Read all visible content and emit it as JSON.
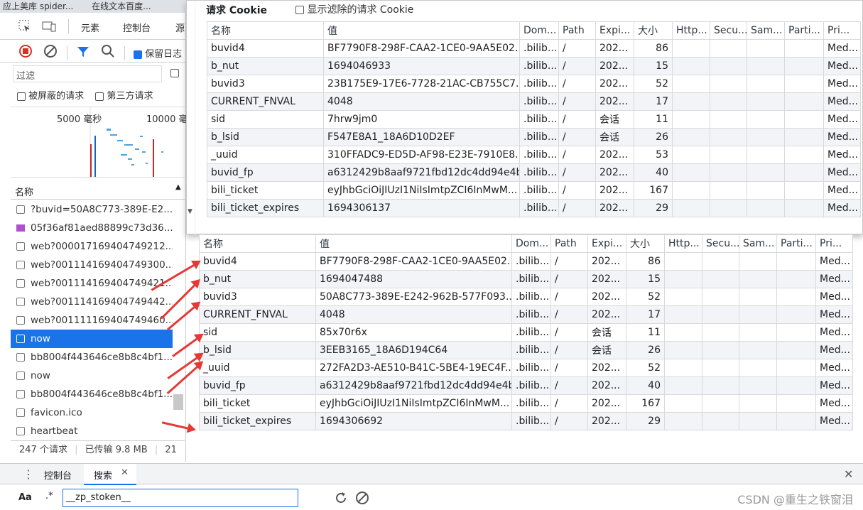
{
  "browser_tabs": [
    "应上美库 spider...",
    "在线文本百度..."
  ],
  "devtools": {
    "panels": [
      "元素",
      "控制台",
      "源"
    ],
    "preserve_log": "保留日志",
    "filter_placeholder": "过滤",
    "blocked_requests": "被屏蔽的请求",
    "third_party": "第三方请求",
    "overview_labels": [
      "5000 毫秒",
      "10000 毫"
    ],
    "name_header": "名称",
    "requests": [
      {
        "name": "?buvid=50A8C773-389E-E2...",
        "type": "doc"
      },
      {
        "name": "05f36af81aed88899c73d36...",
        "type": "img"
      },
      {
        "name": "web?000017169404749212...",
        "type": "doc"
      },
      {
        "name": "web?001114169404749300...",
        "type": "doc"
      },
      {
        "name": "web?001114169404749421...",
        "type": "doc"
      },
      {
        "name": "web?001114169404749442...",
        "type": "doc"
      },
      {
        "name": "web?001111169404749460...",
        "type": "doc"
      },
      {
        "name": "now",
        "type": "doc",
        "selected": true
      },
      {
        "name": "bb8004f443646ce8b8c4bf1...",
        "type": "doc"
      },
      {
        "name": "now",
        "type": "doc"
      },
      {
        "name": "bb8004f443646ce8b8c4bf1...",
        "type": "doc"
      },
      {
        "name": "favicon.ico",
        "type": "doc"
      },
      {
        "name": "heartbeat",
        "type": "doc"
      }
    ],
    "status": {
      "requests": "247 个请求",
      "transferred": "已传输 9.8 MB",
      "extra": "21"
    },
    "drawer_tabs": [
      "控制台",
      "搜索"
    ],
    "search": {
      "aa": "Aa",
      "regex": ".*",
      "value": "__zp_stoken__"
    }
  },
  "popup": {
    "title": "请求 Cookie",
    "show_filtered": "显示滤除的请求 Cookie"
  },
  "columns": [
    "名称",
    "值",
    "Dom...",
    "Path",
    "Expi...",
    "大小",
    "Http...",
    "Secu...",
    "Sam...",
    "Parti...",
    "Pri..."
  ],
  "cookies_top": [
    [
      "buvid4",
      "BF7790F8-298F-CAA2-1CE0-9AA5E02...",
      ".bilib...",
      "/",
      "202...",
      "86",
      "",
      "",
      "",
      "",
      "Med..."
    ],
    [
      "b_nut",
      "1694046933",
      ".bilib...",
      "/",
      "202...",
      "15",
      "",
      "",
      "",
      "",
      "Med..."
    ],
    [
      "buvid3",
      "23B175E9-17E6-7728-21AC-CB755C7...",
      ".bilib...",
      "/",
      "202...",
      "52",
      "",
      "",
      "",
      "",
      "Med..."
    ],
    [
      "CURRENT_FNVAL",
      "4048",
      ".bilib...",
      "/",
      "202...",
      "17",
      "",
      "",
      "",
      "",
      "Med..."
    ],
    [
      "sid",
      "7hrw9jm0",
      ".bilib...",
      "/",
      "会话",
      "11",
      "",
      "",
      "",
      "",
      "Med..."
    ],
    [
      "b_lsid",
      "F547E8A1_18A6D10D2EF",
      ".bilib...",
      "/",
      "会话",
      "26",
      "",
      "",
      "",
      "",
      "Med..."
    ],
    [
      "_uuid",
      "310FFADC9-ED5D-AF98-E23E-7910E8...",
      ".bilib...",
      "/",
      "202...",
      "53",
      "",
      "",
      "",
      "",
      "Med..."
    ],
    [
      "buvid_fp",
      "a6312429b8aaf9721fbd12dc4dd94e4b",
      ".bilib...",
      "/",
      "202...",
      "40",
      "",
      "",
      "",
      "",
      "Med..."
    ],
    [
      "bili_ticket",
      "eyJhbGciOiJIUzI1NiIsImtpZCI6InMwM...",
      ".bilib...",
      "/",
      "202...",
      "167",
      "",
      "",
      "",
      "",
      "Med..."
    ],
    [
      "bili_ticket_expires",
      "1694306137",
      ".bilib...",
      "/",
      "202...",
      "29",
      "",
      "",
      "",
      "",
      "Med..."
    ]
  ],
  "cookies_bottom": [
    [
      "buvid4",
      "BF7790F8-298F-CAA2-1CE0-9AA5E02...",
      ".bilib...",
      "/",
      "202...",
      "86",
      "",
      "",
      "",
      "",
      "Med..."
    ],
    [
      "b_nut",
      "1694047488",
      ".bilib...",
      "/",
      "202...",
      "15",
      "",
      "",
      "",
      "",
      "Med..."
    ],
    [
      "buvid3",
      "50A8C773-389E-E242-962B-577F093...",
      ".bilib...",
      "/",
      "202...",
      "52",
      "",
      "",
      "",
      "",
      "Med..."
    ],
    [
      "CURRENT_FNVAL",
      "4048",
      ".bilib...",
      "/",
      "202...",
      "17",
      "",
      "",
      "",
      "",
      "Med..."
    ],
    [
      "sid",
      "85x70r6x",
      ".bilib...",
      "/",
      "会话",
      "11",
      "",
      "",
      "",
      "",
      "Med..."
    ],
    [
      "b_lsid",
      "3EEB3165_18A6D194C64",
      ".bilib...",
      "/",
      "会话",
      "26",
      "",
      "",
      "",
      "",
      "Med..."
    ],
    [
      "_uuid",
      "272FA2D3-AE510-B41C-5BE4-19EC4F...",
      ".bilib...",
      "/",
      "202...",
      "52",
      "",
      "",
      "",
      "",
      "Med..."
    ],
    [
      "buvid_fp",
      "a6312429b8aaf9721fbd12dc4dd94e4b",
      ".bilib...",
      "/",
      "202...",
      "40",
      "",
      "",
      "",
      "",
      "Med..."
    ],
    [
      "bili_ticket",
      "eyJhbGciOiJIUzI1NiIsImtpZCI6InMwM...",
      ".bilib...",
      "/",
      "202...",
      "167",
      "",
      "",
      "",
      "",
      "Med..."
    ],
    [
      "bili_ticket_expires",
      "1694306692",
      ".bilib...",
      "/",
      "202...",
      "29",
      "",
      "",
      "",
      "",
      "Med..."
    ]
  ],
  "watermark": "CSDN @重生之铁窗泪",
  "colors": {
    "accent": "#1a73e8",
    "arrow": "#e53935",
    "stop": "#d93025"
  }
}
